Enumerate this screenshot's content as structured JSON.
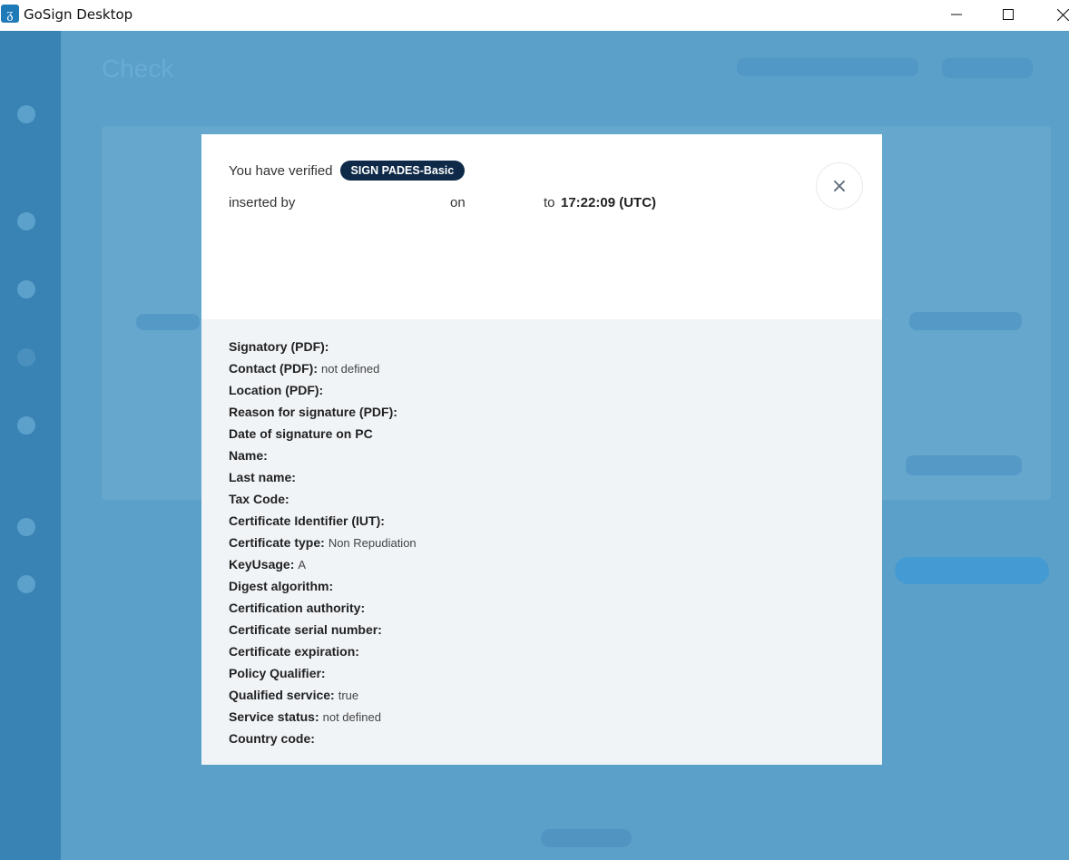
{
  "window": {
    "app_icon_glyph": "ᵹ",
    "title": "GoSign Desktop",
    "controls": {
      "minimize": "minimize-icon",
      "maximize": "maximize-icon",
      "close": "close-icon"
    }
  },
  "background": {
    "page_title": "Check"
  },
  "dialog": {
    "verified_prefix": "You have verified",
    "signature_badge": "SIGN PADES-Basic",
    "inserted_by": "inserted by",
    "on_label": "on",
    "to_label": "to",
    "time": "17:22:09 (UTC)",
    "close_glyph": "×",
    "details": [
      {
        "label": "Signatory (PDF):",
        "value": ""
      },
      {
        "label": "Contact (PDF):",
        "value": "not defined"
      },
      {
        "label": "Location (PDF):",
        "value": ""
      },
      {
        "label": "Reason for signature (PDF):",
        "value": ""
      },
      {
        "label": "Date of signature on PC",
        "value": ""
      },
      {
        "label": "Name:",
        "value": ""
      },
      {
        "label": "Last name:",
        "value": ""
      },
      {
        "label": "Tax Code:",
        "value": ""
      },
      {
        "label": "Certificate Identifier (IUT):",
        "value": ""
      },
      {
        "label": "Certificate type:",
        "value": "Non Repudiation"
      },
      {
        "label": "KeyUsage:",
        "value": "A"
      },
      {
        "label": "Digest algorithm:",
        "value": ""
      },
      {
        "label": "Certification authority:",
        "value": ""
      },
      {
        "label": "Certificate serial number:",
        "value": ""
      },
      {
        "label": "Certificate expiration:",
        "value": ""
      },
      {
        "label": "Policy Qualifier:",
        "value": ""
      },
      {
        "label": "Qualified service:",
        "value": "true"
      },
      {
        "label": "Service status:",
        "value": "not defined"
      },
      {
        "label": "Country code:",
        "value": ""
      }
    ]
  },
  "colors": {
    "badge_bg": "#0e2a48",
    "overlay": "#5ba0c9",
    "sidebar": "#3983b4",
    "details_bg": "#f1f4f7"
  }
}
